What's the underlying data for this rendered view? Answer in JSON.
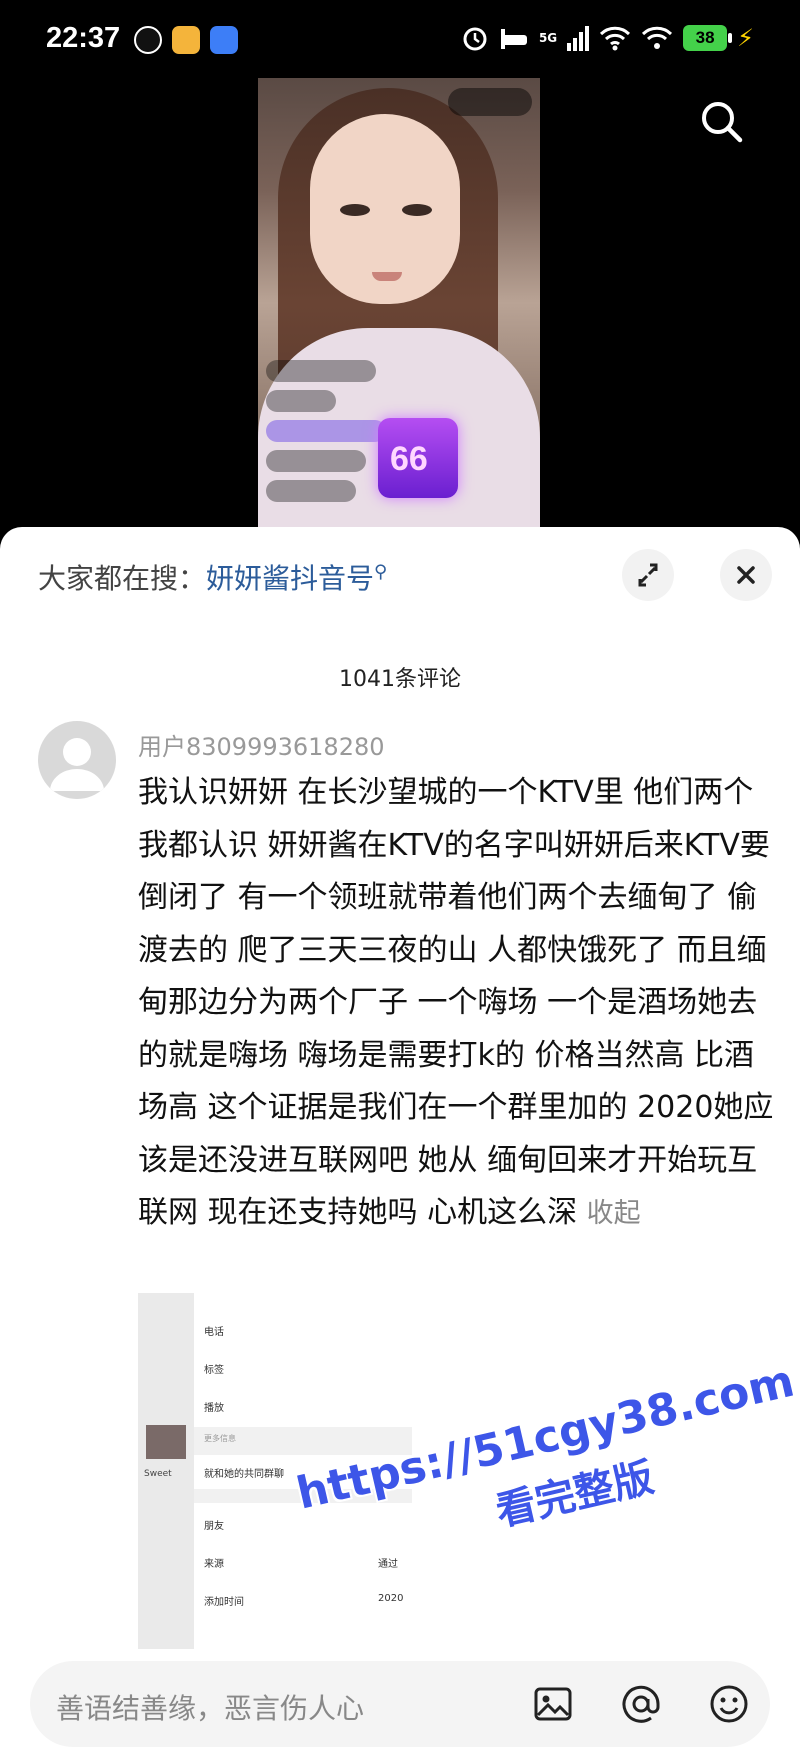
{
  "status_bar": {
    "time": "22:37",
    "network": "5G",
    "battery": "38",
    "icons": [
      "qq-icon",
      "weibo-icon",
      "baidu-icon",
      "alarm-icon",
      "sleep-icon",
      "cellular-signal-icon",
      "wifi-icon",
      "hotspot-icon",
      "charging-icon"
    ]
  },
  "video": {
    "search_icon": "search-icon"
  },
  "panel": {
    "search_prefix": "大家都在搜：",
    "search_keyword": "妍妍酱抖音号",
    "comment_count": "1041条评论"
  },
  "comment": {
    "username": "用户8309993618280",
    "text": "我认识妍妍 在长沙望城的一个KTV里 他们两个我都认识 妍妍酱在KTV的名字叫妍妍后来KTV要倒闭了 有一个领班就带着他们两个去缅甸了 偷渡去的  爬了三天三夜的山 人都快饿死了 而且缅甸那边分为两个厂子 一个嗨场 一个是酒场她去的就是嗨场 嗨场是需要打k的 价格当然高 比酒场高 这个证据是我们在一个群里加的 2020她应该是还没进互联网吧 她从 缅甸回来才开始玩互联网 现在还支持她吗 心机这么深",
    "collapse_label": "收起",
    "attachment_menu": [
      "电话",
      "标签",
      "播放",
      "更多信息",
      "就和她的共同群聊",
      "朋友",
      "来源",
      "添加时间"
    ],
    "attachment_right": [
      "通过",
      "2020"
    ],
    "attachment_left_label": "Sweet"
  },
  "input": {
    "placeholder": "善语结善缘，恶言伤人心"
  },
  "watermark": {
    "url": "https://51cgy38.com",
    "sub": "看完整版"
  }
}
